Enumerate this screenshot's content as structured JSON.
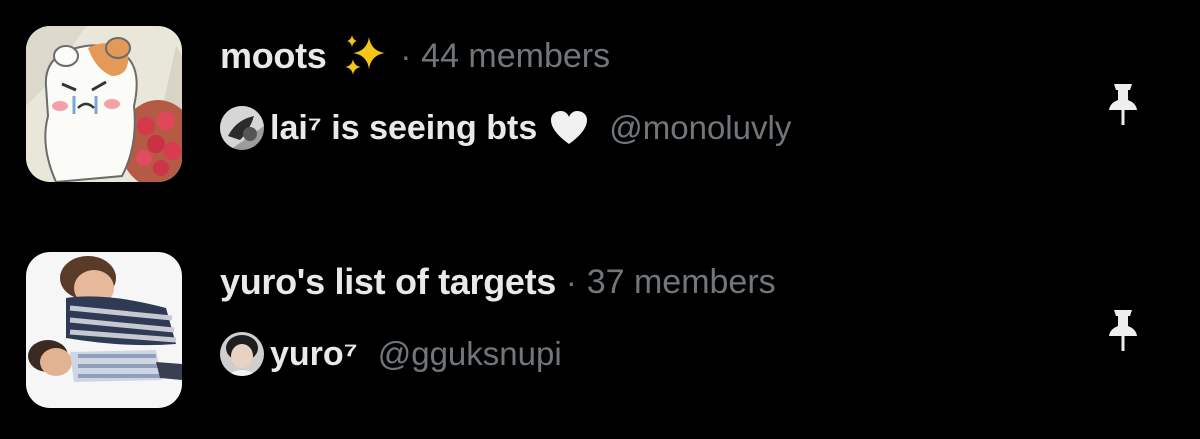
{
  "lists": [
    {
      "name": "moots",
      "emoji_icon": "sparkles-icon",
      "separator": "·",
      "members": "44 members",
      "owner_name": "lai⁷ is seeing bts",
      "owner_emoji_icon": "white-heart-icon",
      "owner_handle": "@monoluvly",
      "pin_icon": "pin-icon"
    },
    {
      "name": "yuro's list of targets",
      "separator": "·",
      "members": "37 members",
      "owner_name": "yuro⁷",
      "owner_handle": "@gguksnupi",
      "pin_icon": "pin-icon"
    }
  ],
  "colors": {
    "background": "#000000",
    "primary_text": "#e7e9ea",
    "secondary_text": "#71767b",
    "sparkle": "#f5c518"
  }
}
